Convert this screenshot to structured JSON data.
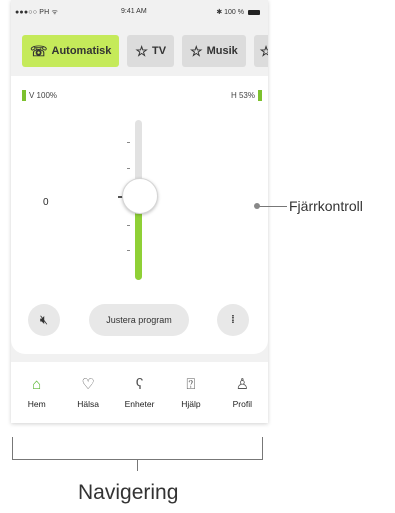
{
  "status_bar": {
    "carrier": "●●●○○ PH ᯤ",
    "time": "9:41 AM",
    "battery": "✱ 100 %"
  },
  "tabs": [
    {
      "label": "Automatisk",
      "icon": "ear-icon",
      "active": true
    },
    {
      "label": "TV",
      "icon": "star-icon",
      "active": false
    },
    {
      "label": "Musik",
      "icon": "star-icon",
      "active": false
    }
  ],
  "battery_left": {
    "label": "V 100%",
    "level": 1.0
  },
  "battery_right": {
    "label": "H 53%",
    "level": 0.53
  },
  "volume": {
    "value": "0"
  },
  "controls": {
    "mute_icon": "speaker-mute-icon",
    "adjust_label": "Justera program",
    "balance_icon": "balance-icon"
  },
  "nav": [
    {
      "label": "Hem",
      "icon": "home-icon",
      "active": true
    },
    {
      "label": "Hälsa",
      "icon": "heart-icon",
      "active": false
    },
    {
      "label": "Enheter",
      "icon": "hearing-aid-icon",
      "active": false
    },
    {
      "label": "Hjälp",
      "icon": "help-icon",
      "active": false
    },
    {
      "label": "Profil",
      "icon": "profile-icon",
      "active": false
    }
  ],
  "annotations": {
    "remote_label": "Fjärrkontroll",
    "nav_label": "Navigering"
  },
  "colors": {
    "accent": "#c5ea5a",
    "slider_fill": "#8fd036",
    "active_nav": "#58b530"
  }
}
